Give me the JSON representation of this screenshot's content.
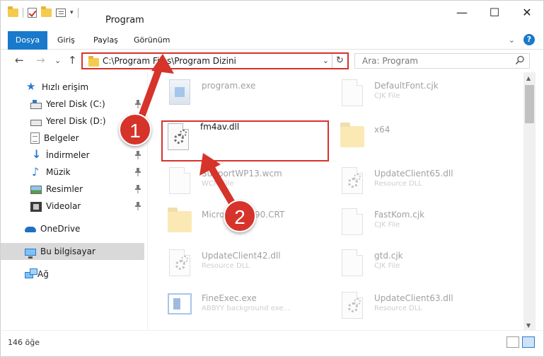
{
  "window": {
    "title": "Program",
    "minimize_glyph": "—",
    "maximize_glyph": "☐",
    "close_glyph": "✕"
  },
  "quick_access_toolbar": {
    "icons": [
      "folder-icon",
      "properties-check-icon",
      "new-folder-icon",
      "properties-icon",
      "customize-dropdown-icon"
    ],
    "dropdown_glyph": "▾"
  },
  "ribbon": {
    "tabs": [
      {
        "label": "Dosya",
        "active": true
      },
      {
        "label": "Giriş"
      },
      {
        "label": "Paylaş"
      },
      {
        "label": "Görünüm"
      }
    ],
    "expand_glyph": "⌄",
    "help_glyph": "?"
  },
  "navigation": {
    "back_glyph": "←",
    "forward_glyph": "→",
    "recent_glyph": "⌄",
    "up_glyph": "↑"
  },
  "address_bar": {
    "path": "C:\\Program Files\\Program Dizini",
    "dropdown_glyph": "⌄",
    "refresh_glyph": "↻"
  },
  "search": {
    "placeholder": "Ara: Program"
  },
  "sidebar": {
    "items": [
      {
        "label": "Hızlı erişim",
        "icon": "star-icon"
      },
      {
        "label": "Yerel Disk (C:)",
        "icon": "drive-icon",
        "pinned": true
      },
      {
        "label": "Yerel Disk (D:)",
        "icon": "drive-icon",
        "pinned": true
      },
      {
        "label": "Belgeler",
        "icon": "document-icon",
        "pinned": true
      },
      {
        "label": "İndirmeler",
        "icon": "download-icon",
        "pinned": true
      },
      {
        "label": "Müzik",
        "icon": "music-icon",
        "pinned": true
      },
      {
        "label": "Resimler",
        "icon": "pictures-icon",
        "pinned": true
      },
      {
        "label": "Videolar",
        "icon": "video-icon",
        "pinned": true
      },
      {
        "label": "OneDrive",
        "icon": "cloud-icon"
      },
      {
        "label": "Bu bilgisayar",
        "icon": "computer-icon",
        "selected": true
      },
      {
        "label": "Ağ",
        "icon": "network-icon"
      }
    ]
  },
  "files": [
    {
      "name": "program.exe",
      "type": "",
      "icon": "application-icon"
    },
    {
      "name": "DefaultFont.cjk",
      "type": "CJK File",
      "icon": "file-icon"
    },
    {
      "name": "fm4av.dll",
      "type": "",
      "icon": "dll-gear-icon",
      "highlighted": true
    },
    {
      "name": "x64",
      "type": "",
      "icon": "folder-icon"
    },
    {
      "name": "SupportWP13.wcm",
      "type": "WCM File",
      "icon": "file-icon"
    },
    {
      "name": "UpdateClient65.dll",
      "type": "Resource DLL",
      "icon": "dll-gear-icon"
    },
    {
      "name": "Microsoft.VC90.CRT",
      "type": "",
      "icon": "folder-icon"
    },
    {
      "name": "FastKom.cjk",
      "type": "CJK File",
      "icon": "file-icon"
    },
    {
      "name": "UpdateClient42.dll",
      "type": "Resource DLL",
      "icon": "dll-gear-icon"
    },
    {
      "name": "gtd.cjk",
      "type": "CJK File",
      "icon": "file-icon"
    },
    {
      "name": "FineExec.exe",
      "type": "ABBYY background exe...",
      "icon": "fine-exec-icon"
    },
    {
      "name": "UpdateClient63.dll",
      "type": "Resource DLL",
      "icon": "dll-gear-icon"
    }
  ],
  "status": {
    "item_count": "146 öğe"
  },
  "callouts": [
    {
      "number": "1",
      "color": "#d6332b"
    },
    {
      "number": "2",
      "color": "#d6332b"
    }
  ],
  "colors": {
    "accent": "#1979ca",
    "highlight_red": "#d6332b",
    "selected_bg": "#d9d9d9"
  }
}
